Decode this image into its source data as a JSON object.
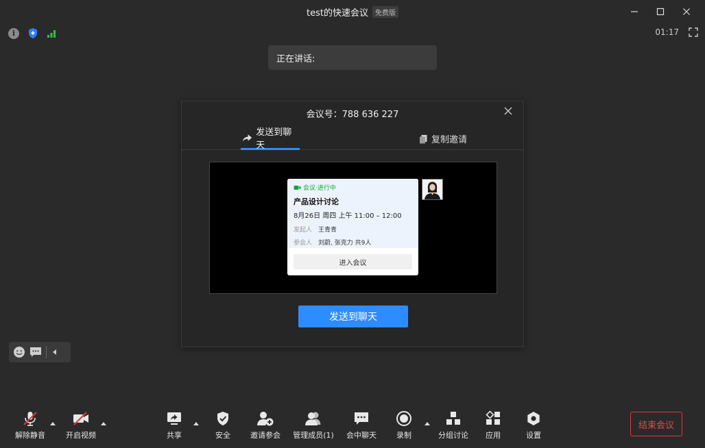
{
  "window": {
    "title": "test的快速会议",
    "badge": "免费版"
  },
  "status": {
    "timer": "01:17"
  },
  "speaking": {
    "label": "正在讲话:"
  },
  "invite_dialog": {
    "title": "会议号：788 636 227",
    "tabs": [
      {
        "label": "发送到聊天",
        "active": true
      },
      {
        "label": "复制邀请",
        "active": false
      }
    ],
    "card": {
      "status": "会议·进行中",
      "title": "产品设计讨论",
      "time": "8月26日 周四 上午 11:00 – 12:00",
      "organizer_label": "发起人",
      "organizer": "王青青",
      "participants_label": "参会人",
      "participants": "刘蔚, 张克力 共9人",
      "join_button": "进入会议"
    },
    "send_button": "发送到聊天"
  },
  "toolbar": {
    "mute": "解除静音",
    "video": "开启视频",
    "share": "共享",
    "security": "安全",
    "invite": "邀请参会",
    "manage": "管理成员(1)",
    "chat": "会中聊天",
    "record": "录制",
    "breakout": "分组讨论",
    "apps": "应用",
    "settings": "设置",
    "end": "结束会议"
  },
  "colors": {
    "accent": "#2d8cff",
    "end_red": "#e64a4f",
    "signal_green": "#2ec04d",
    "status_green": "#18a33a"
  }
}
